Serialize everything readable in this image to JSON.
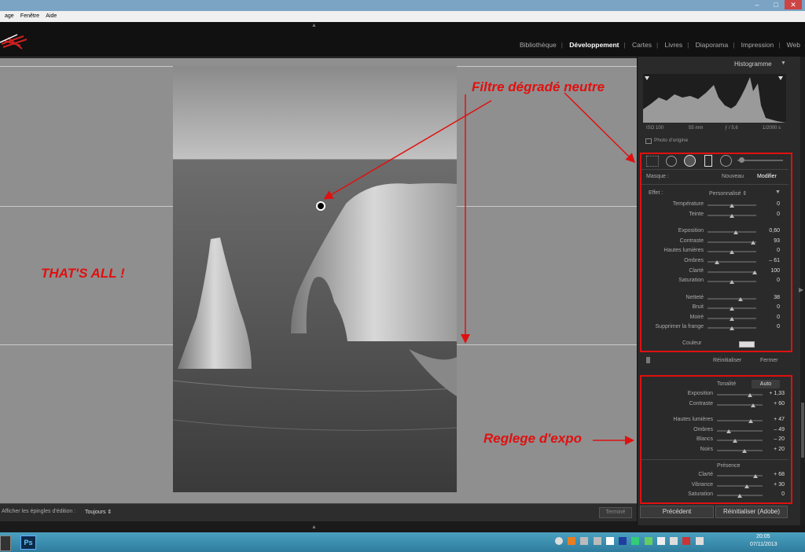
{
  "window": {
    "menu": [
      "age",
      "Fenêtre",
      "Aide"
    ]
  },
  "modules": {
    "items": [
      "Bibliothèque",
      "Développement",
      "Cartes",
      "Livres",
      "Diaporama",
      "Impression",
      "Web"
    ],
    "active": "Développement"
  },
  "histogram": {
    "title": "Histogramme",
    "iso": "ISO 100",
    "focal": "55 mm",
    "aperture": "ƒ / 5,6",
    "shutter": "1/2000 s",
    "original_photo": "Photo d'origine"
  },
  "mask": {
    "label": "Masque :",
    "new": "Nouveau",
    "edit": "Modifier",
    "effect_label": "Effet :",
    "effect_value": "Personnalisé ⇕",
    "sliders": [
      {
        "name": "Température",
        "value": "0",
        "pos": 0.5
      },
      {
        "name": "Teinte",
        "value": "0",
        "pos": 0.5
      },
      {
        "name": "Exposition",
        "value": "0,60",
        "pos": 0.58
      },
      {
        "name": "Contraste",
        "value": "93",
        "pos": 0.93
      },
      {
        "name": "Hautes lumières",
        "value": "0",
        "pos": 0.5
      },
      {
        "name": "Ombres",
        "value": "– 61",
        "pos": 0.2
      },
      {
        "name": "Clarté",
        "value": "100",
        "pos": 0.97
      },
      {
        "name": "Saturation",
        "value": "0",
        "pos": 0.5
      },
      {
        "name": "Netteté",
        "value": "38",
        "pos": 0.68
      },
      {
        "name": "Bruit",
        "value": "0",
        "pos": 0.5
      },
      {
        "name": "Moiré",
        "value": "0",
        "pos": 0.5
      },
      {
        "name": "Supprimer la frange",
        "value": "0",
        "pos": 0.5
      }
    ],
    "color_label": "Couleur",
    "reset": "Réinitialiser",
    "close": "Fermer"
  },
  "basic": {
    "tone_label": "Tonalité",
    "auto": "Auto",
    "sliders": [
      {
        "name": "Exposition",
        "value": "+ 1,33",
        "pos": 0.72
      },
      {
        "name": "Contraste",
        "value": "+ 60",
        "pos": 0.8
      },
      {
        "name": "Hautes lumières",
        "value": "+ 47",
        "pos": 0.74
      },
      {
        "name": "Ombres",
        "value": "– 49",
        "pos": 0.25
      },
      {
        "name": "Blancs",
        "value": "– 20",
        "pos": 0.4
      },
      {
        "name": "Noirs",
        "value": "+ 20",
        "pos": 0.6
      }
    ],
    "presence_label": "Présence",
    "presence": [
      {
        "name": "Clarté",
        "value": "+ 68",
        "pos": 0.84
      },
      {
        "name": "Vibrance",
        "value": "+ 30",
        "pos": 0.65
      },
      {
        "name": "Saturation",
        "value": "0",
        "pos": 0.5
      }
    ]
  },
  "footer": {
    "previous": "Précédent",
    "reset_adobe": "Réinitialiser (Adobe)"
  },
  "toolbar": {
    "pins_label": "Afficher les épingles d'édition :",
    "pins_value": "Toujours ⇕",
    "done": "Terminé"
  },
  "annotations": {
    "gradient": "Filtre dégradé neutre",
    "thats_all": "THAT'S ALL !",
    "exposure": "Reglege d'expo"
  },
  "taskbar": {
    "time": "20:05",
    "date": "07/11/2013",
    "ps": "Ps"
  }
}
